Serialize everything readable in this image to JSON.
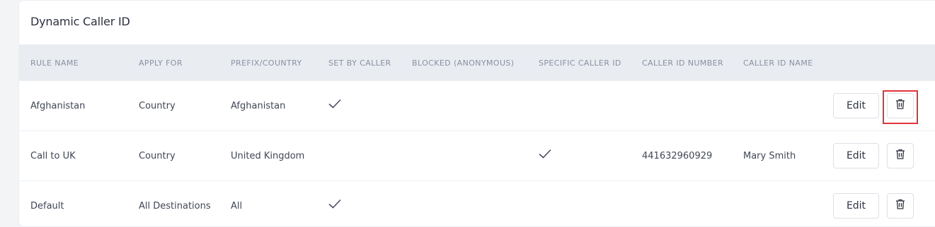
{
  "card": {
    "title": "Dynamic Caller ID"
  },
  "table": {
    "headers": [
      "RULE NAME",
      "APPLY FOR",
      "PREFIX/COUNTRY",
      "SET BY CALLER",
      "BLOCKED (ANONYMOUS)",
      "SPECIFIC CALLER ID",
      "CALLER ID NUMBER",
      "CALLER ID NAME"
    ],
    "rows": [
      {
        "rule_name": "Afghanistan",
        "apply_for": "Country",
        "prefix": "Afghanistan",
        "set_by_caller": true,
        "blocked": false,
        "specific": false,
        "number": "",
        "name": "",
        "edit_label": "Edit"
      },
      {
        "rule_name": "Call to UK",
        "apply_for": "Country",
        "prefix": "United Kingdom",
        "set_by_caller": false,
        "blocked": false,
        "specific": true,
        "number": "441632960929",
        "name": "Mary Smith",
        "edit_label": "Edit"
      },
      {
        "rule_name": "Default",
        "apply_for": "All Destinations",
        "prefix": "All",
        "set_by_caller": true,
        "blocked": false,
        "specific": false,
        "number": "",
        "name": "",
        "edit_label": "Edit"
      }
    ]
  },
  "icons": {
    "check": "check-icon",
    "delete": "trash-icon"
  },
  "colors": {
    "highlight": "#e0343a",
    "header_bg": "#e9ecf1"
  }
}
